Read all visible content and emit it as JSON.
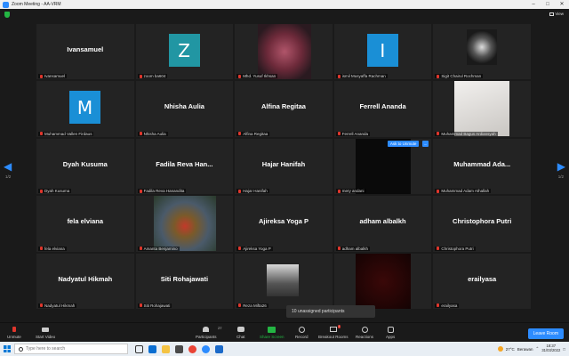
{
  "window": {
    "title": "Zoom Meeting - AA-VRM"
  },
  "view": {
    "label": "View"
  },
  "pages": {
    "left": "1/2",
    "right": "1/2"
  },
  "tiles": [
    {
      "display": "Ivansamuel",
      "name": "Ivansamuel",
      "kind": "text"
    },
    {
      "display": "Z",
      "name": "zoom ba604",
      "kind": "letter-teal"
    },
    {
      "display": "",
      "name": "Mhd. Yusuf Ikhsan",
      "kind": "photo-art"
    },
    {
      "display": "I",
      "name": "ismil Musyaffa Rachman",
      "kind": "letter"
    },
    {
      "display": "",
      "name": "Sigit Chairul Rochman",
      "kind": "photo-emblem"
    },
    {
      "display": "M",
      "name": "Muhammad Vallen Firdaus",
      "kind": "letter"
    },
    {
      "display": "Nhisha Aulia",
      "name": "Nhisha Aulia",
      "kind": "text"
    },
    {
      "display": "Alfina Regitaa",
      "name": "Alfina Regitaa",
      "kind": "text"
    },
    {
      "display": "Ferrell Ananda",
      "name": "Ferrell Ananda",
      "kind": "text"
    },
    {
      "display": "",
      "name": "Muhammad Bagus Ardiansyah",
      "kind": "photo-white"
    },
    {
      "display": "Dyah Kusuma",
      "name": "Dyah Kusuma",
      "kind": "text"
    },
    {
      "display": "Fadila Reva Han...",
      "name": "Fadila Reva Hanandita",
      "kind": "text"
    },
    {
      "display": "Hajar Hanifah",
      "name": "Hajar Hanifah",
      "kind": "text"
    },
    {
      "display": "",
      "name": "mery andani",
      "kind": "dark-video"
    },
    {
      "display": "Muhammad Ada...",
      "name": "Muhammad Adam Athallah",
      "kind": "text"
    },
    {
      "display": "fela elviana",
      "name": "fela elviana",
      "kind": "text"
    },
    {
      "display": "",
      "name": "Amanta Benjamino",
      "kind": "photo-jacket"
    },
    {
      "display": "Ajireksa Yoga P",
      "name": "Ajireksa Yoga P",
      "kind": "text"
    },
    {
      "display": "adham albalkh",
      "name": "adham albalkh",
      "kind": "text"
    },
    {
      "display": "Christophora Putri",
      "name": "Christophora Putri",
      "kind": "text"
    },
    {
      "display": "Nadyatul Hikmah",
      "name": "Nadyatul Hikmah",
      "kind": "text"
    },
    {
      "display": "Siti Rohajawati",
      "name": "Siti Rohajawati",
      "kind": "text"
    },
    {
      "display": "",
      "name": "Reza Mifta26",
      "kind": "photo-person"
    },
    {
      "display": "",
      "name": "",
      "kind": "dark-red"
    },
    {
      "display": "erailyasa",
      "name": "erailyasa",
      "kind": "text"
    }
  ],
  "overlay": {
    "add_to_unmute": "Ask to Unmute",
    "more": "...",
    "unassigned": "10 unassigned participants"
  },
  "controls": {
    "unmute": "Unmute",
    "start_video": "Start Video",
    "participants": "Participants",
    "participants_count": "27",
    "chat": "Chat",
    "share_screen": "Share Screen",
    "record": "Record",
    "breakout_rooms": "Breakout Rooms",
    "reactions": "Reactions",
    "apps": "Apps",
    "leave": "Leave Room"
  },
  "taskbar": {
    "search_placeholder": "Type here to search",
    "temperature": "27°C",
    "weather": "Berawan",
    "time": "18:37",
    "date": "31/03/2022"
  },
  "colors": {
    "accent": "#2d8cff",
    "muted_mic": "#e0362c",
    "share_green": "#23b543",
    "tile_bg": "#232323"
  }
}
